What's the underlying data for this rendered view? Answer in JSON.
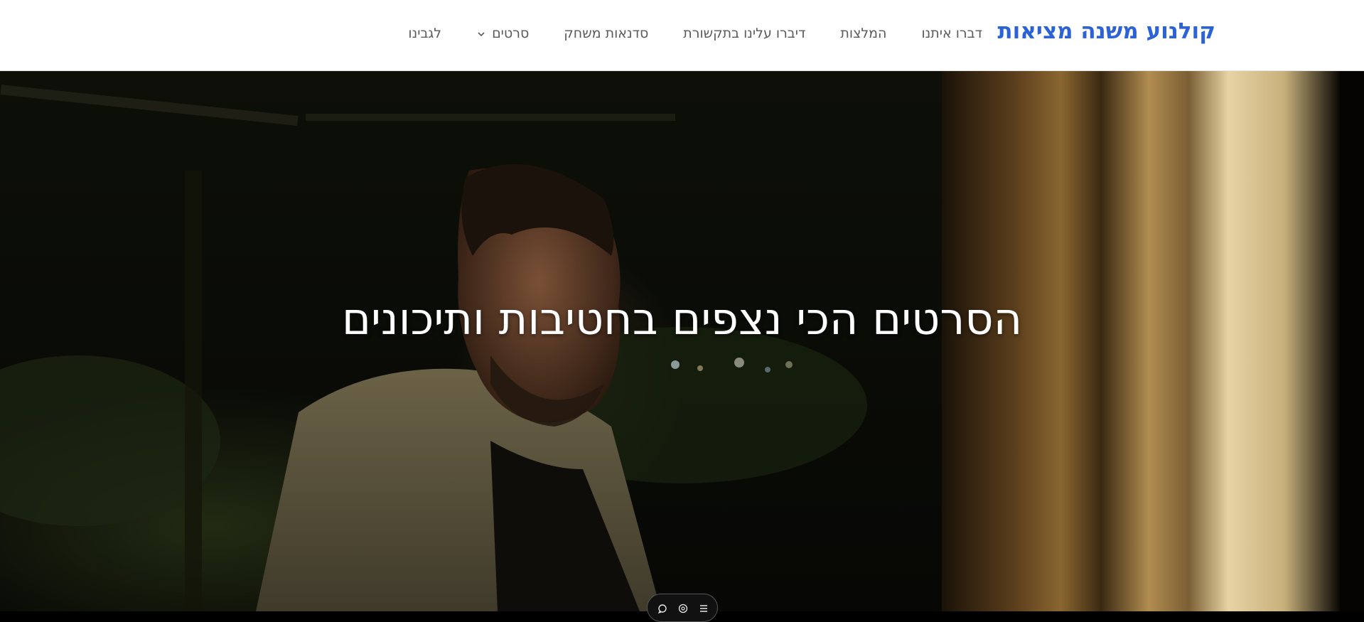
{
  "header": {
    "logo": "קולנוע משנה מציאות",
    "nav": [
      {
        "label": "לגבינו",
        "dropdown": false
      },
      {
        "label": "סרטים",
        "dropdown": true
      },
      {
        "label": "סדנאות משחק",
        "dropdown": false
      },
      {
        "label": "דיברו עלינו בתקשורת",
        "dropdown": false
      },
      {
        "label": "המלצות",
        "dropdown": false
      },
      {
        "label": "דברו איתנו",
        "dropdown": false
      }
    ],
    "icons": {
      "dropdown": "chevron-down-icon"
    }
  },
  "hero": {
    "title": "הסרטים הכי נצפים בחטיבות ותיכונים",
    "image": "man-in-grey-hoodie-at-night-window"
  },
  "widget": {
    "icons": [
      "chat-icon",
      "accessibility-icon",
      "menu-icon"
    ]
  },
  "colors": {
    "brand": "#2b63d6",
    "nav_text": "#5a5a5a",
    "header_bg": "#ffffff",
    "hero_title": "#ffffff"
  }
}
